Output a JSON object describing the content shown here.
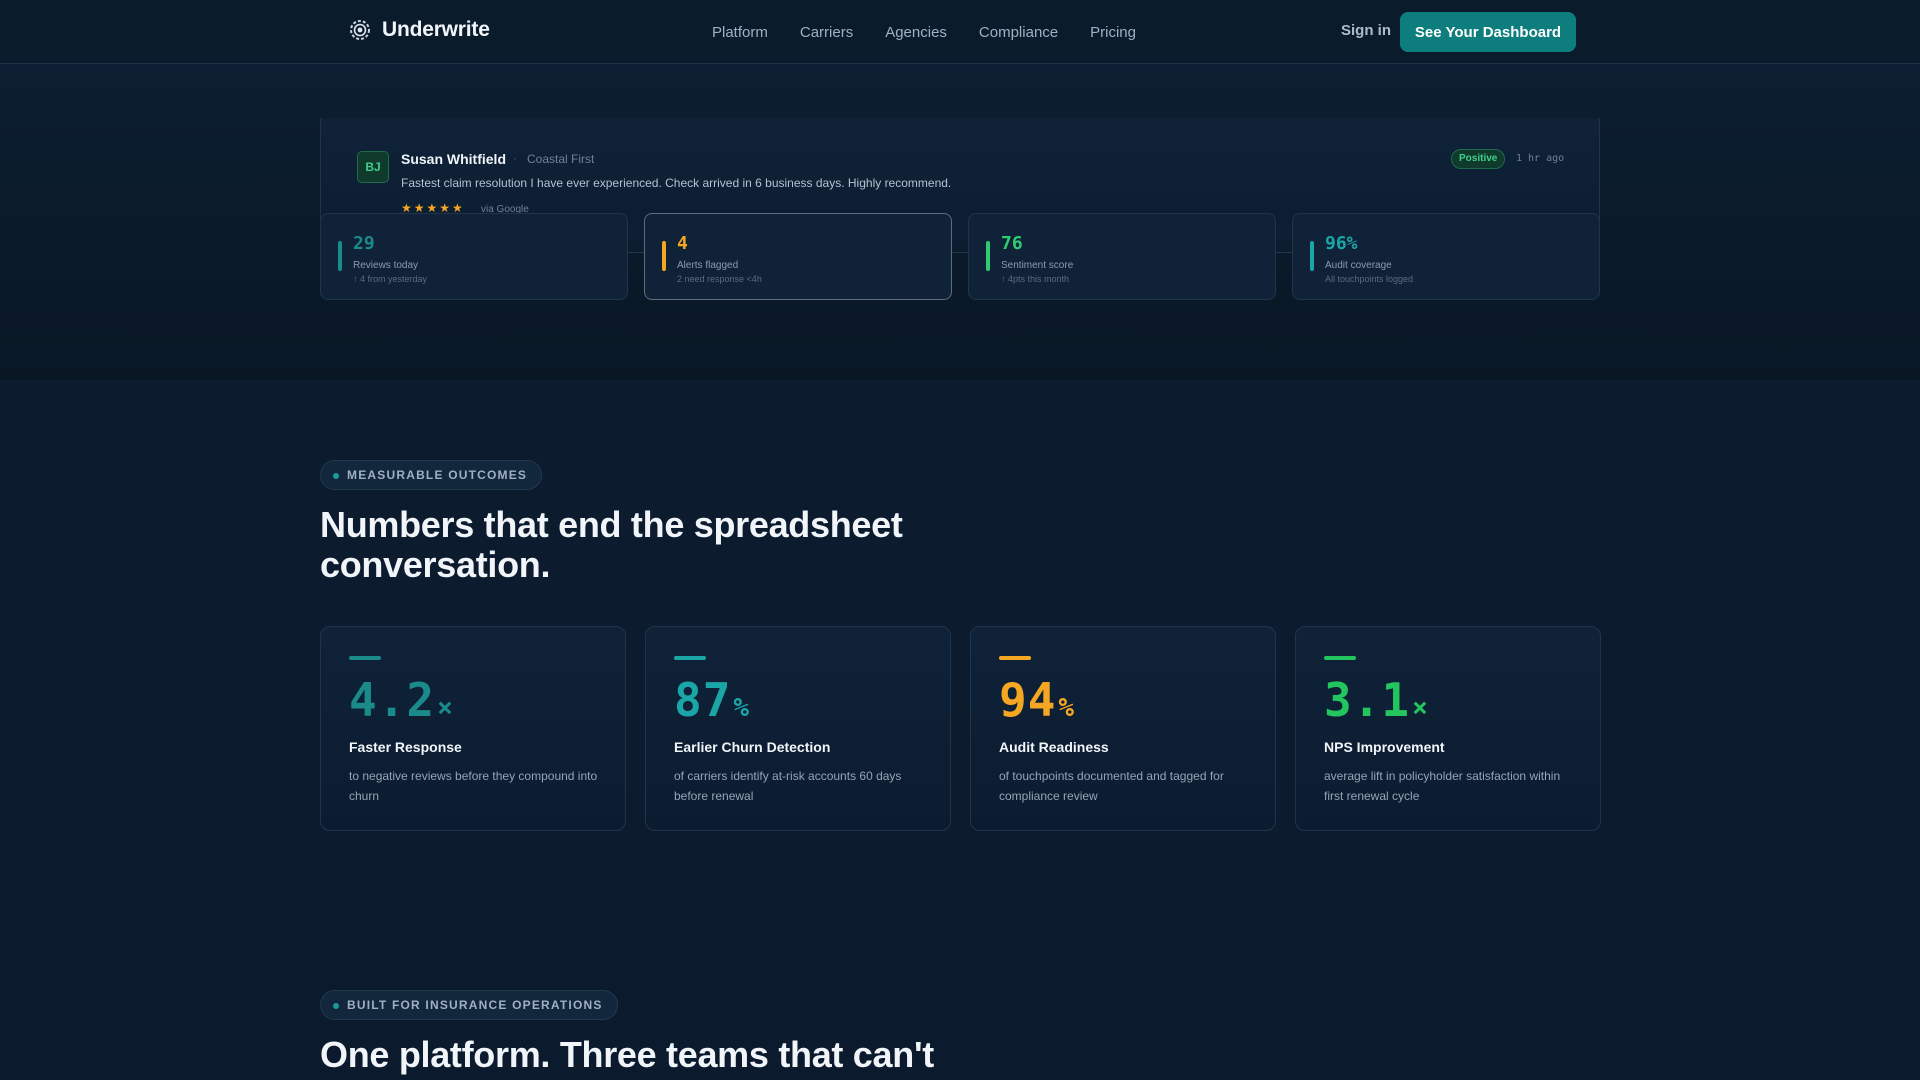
{
  "nav": {
    "brand": "Underwrite",
    "brand_icon": "gear-logo-icon",
    "links": [
      "Platform",
      "Carriers",
      "Agencies",
      "Compliance",
      "Pricing"
    ],
    "signin": "Sign in",
    "cta": "See Your Dashboard"
  },
  "review": {
    "initials": "BJ",
    "name": "Susan Whitfield",
    "separator": "·",
    "company": "Coastal First",
    "text": "Fastest claim resolution I have ever experienced. Check arrived in 6 business days. Highly recommend.",
    "stars": "★★★★★",
    "rating": 5,
    "source": "via Google",
    "sentiment": "Positive",
    "time": "1 hr ago"
  },
  "stats": [
    {
      "value": "29",
      "label": "Reviews today",
      "sub": "↑ 4 from yesterday",
      "color": "#1a8a8a"
    },
    {
      "value": "4",
      "label": "Alerts flagged",
      "sub": "2 need response <4h",
      "color": "#f5a623"
    },
    {
      "value": "76",
      "label": "Sentiment score",
      "sub": "↑ 4pts this month",
      "color": "#2ecc71"
    },
    {
      "value": "96%",
      "label": "Audit coverage",
      "sub": "All touchpoints logged",
      "color": "#1aa6a6"
    }
  ],
  "outcomes": {
    "eyebrow": "MEASURABLE OUTCOMES",
    "headline_line1": "Numbers that end the spreadsheet",
    "headline_line2": "conversation.",
    "metrics": [
      {
        "value": "4.2",
        "unit": "×",
        "title": "Faster Response",
        "desc": "to negative reviews before they compound into churn",
        "color": "#1a8a8a"
      },
      {
        "value": "87",
        "unit": "%",
        "title": "Earlier Churn Detection",
        "desc": "of carriers identify at-risk accounts 60 days before renewal",
        "color": "#1aa6a6"
      },
      {
        "value": "94",
        "unit": "%",
        "title": "Audit Readiness",
        "desc": "of touchpoints documented and tagged for compliance review",
        "color": "#f5a623"
      },
      {
        "value": "3.1",
        "unit": "×",
        "title": "NPS Improvement",
        "desc": "average lift in policyholder satisfaction within first renewal cycle",
        "color": "#22c55e"
      }
    ]
  },
  "platform": {
    "eyebrow": "BUILT FOR INSURANCE OPERATIONS",
    "headline": "One platform. Three teams that can't"
  }
}
